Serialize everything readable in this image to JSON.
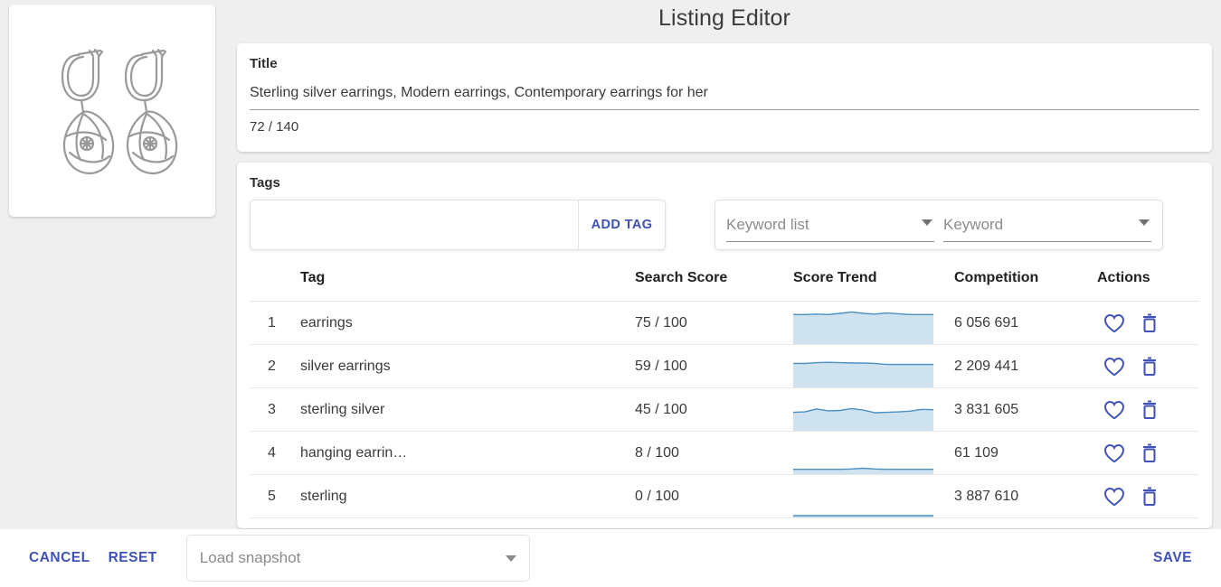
{
  "header": {
    "title": "Listing Editor"
  },
  "product_image": {
    "alt": "sterling silver dangle earrings pair"
  },
  "title_card": {
    "label": "Title",
    "value": "Sterling silver earrings, Modern earrings, Contemporary earrings for her",
    "counter": "72 / 140"
  },
  "tags_card": {
    "label": "Tags",
    "add_tag_input": {
      "value": "",
      "placeholder": ""
    },
    "add_tag_button": "ADD TAG",
    "keyword_list_select": "Keyword list",
    "keyword_select": "Keyword",
    "table": {
      "headers": [
        "",
        "Tag",
        "Search Score",
        "Score Trend",
        "Competition",
        "Actions"
      ],
      "rows": [
        {
          "index": "1",
          "tag": "earrings",
          "search_score": "75 / 100",
          "competition": "6 056 691",
          "trend_level": 75
        },
        {
          "index": "2",
          "tag": "silver earrings",
          "search_score": "59 / 100",
          "competition": "2 209 441",
          "trend_level": 59
        },
        {
          "index": "3",
          "tag": "sterling silver",
          "search_score": "45 / 100",
          "competition": "3 831 605",
          "trend_level": 45
        },
        {
          "index": "4",
          "tag": "hanging earrin…",
          "search_score": "8 / 100",
          "competition": "61 109",
          "trend_level": 8
        },
        {
          "index": "5",
          "tag": "sterling",
          "search_score": "0 / 100",
          "competition": "3 887 610",
          "trend_level": 0
        }
      ],
      "favorite_icon": "heart-icon",
      "delete_icon": "trash-icon"
    }
  },
  "chart_data": {
    "type": "area",
    "title": "Score Trend sparklines",
    "ylim": [
      0,
      100
    ],
    "grid": false,
    "legend": false,
    "series": [
      {
        "name": "earrings",
        "values": [
          75,
          75,
          76,
          75,
          78,
          82,
          78,
          76,
          79,
          77,
          75,
          75,
          75
        ]
      },
      {
        "name": "silver earrings",
        "values": [
          60,
          60,
          62,
          63,
          62,
          61,
          61,
          60,
          57,
          57,
          57,
          57,
          57
        ]
      },
      {
        "name": "sterling silver",
        "values": [
          45,
          46,
          54,
          49,
          50,
          55,
          51,
          44,
          45,
          46,
          48,
          53,
          52
        ]
      },
      {
        "name": "hanging earrings",
        "values": [
          8,
          8,
          8,
          8,
          8,
          9,
          11,
          9,
          8,
          8,
          8,
          8,
          8
        ]
      },
      {
        "name": "sterling",
        "values": [
          0,
          0,
          0,
          0,
          0,
          0,
          0,
          0,
          0,
          0,
          0,
          0,
          0
        ]
      }
    ],
    "colors": {
      "line": "#4a90c4",
      "fill": "#cfe2f0"
    }
  },
  "bottom_bar": {
    "cancel": "CANCEL",
    "reset": "RESET",
    "snapshot_placeholder": "Load snapshot",
    "save": "SAVE"
  },
  "colors": {
    "accent": "#3f51b5",
    "background": "#efefef",
    "card": "#ffffff",
    "text": "#3a3a3a",
    "trend_line": "#4a90c4",
    "trend_fill": "#cfe2f0"
  }
}
